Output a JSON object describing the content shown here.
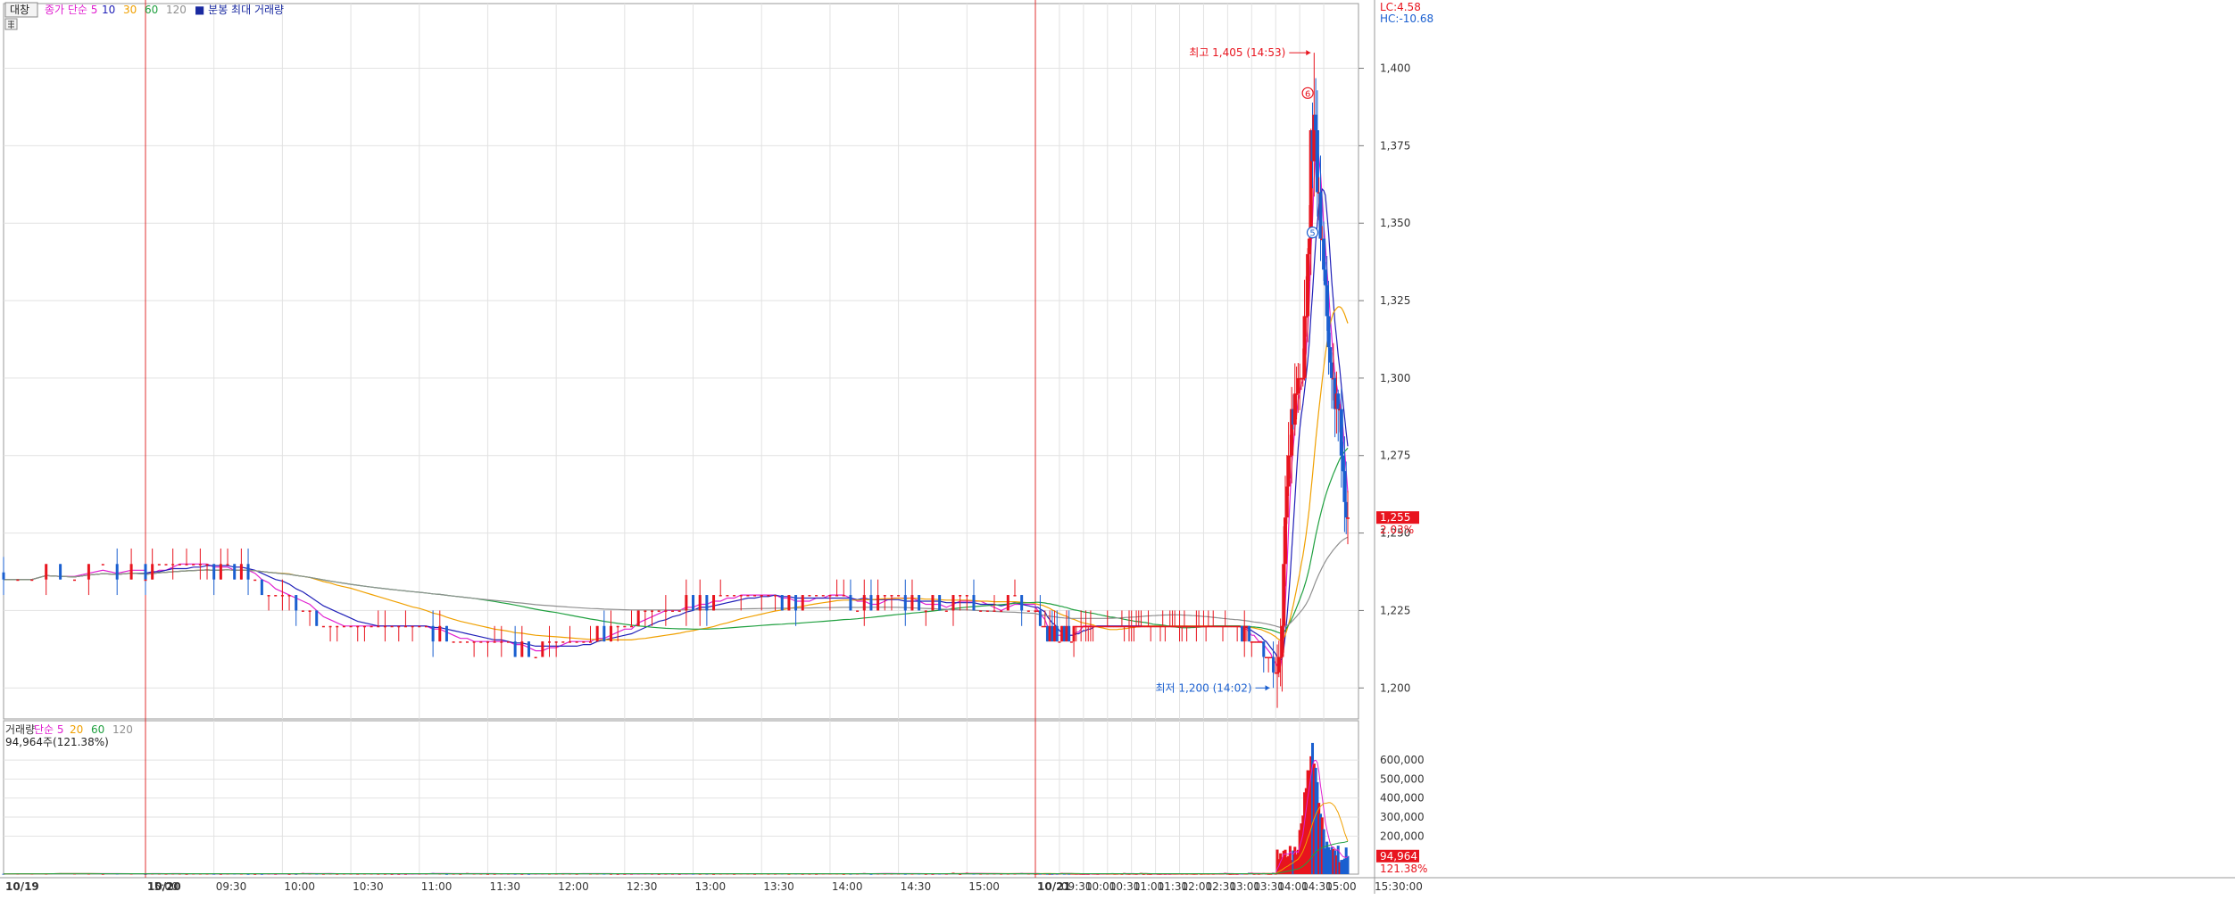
{
  "colors": {
    "up": "#e8141e",
    "down": "#1a5fd0",
    "ma5": "#e020d0",
    "ma10": "#2020b8",
    "ma20": "#f0a000",
    "ma60": "#20a040",
    "ma120": "#909090",
    "grid": "#e2e2e2",
    "axis_text": "#333333",
    "session_line": "#e03030",
    "price_tag_bg": "#e8141e"
  },
  "price_legend": {
    "tool": "대창",
    "items": [
      {
        "text": "종가 단순 5",
        "color": "#e020d0"
      },
      {
        "text": "10",
        "color": "#2020b8"
      },
      {
        "text": "30",
        "color": "#f0a000"
      },
      {
        "text": "60",
        "color": "#20a040"
      },
      {
        "text": "120",
        "color": "#909090"
      },
      {
        "text": "■ 분봉 최대 거래량",
        "color": "#1a2aa0"
      }
    ]
  },
  "volume_legend": {
    "items": [
      {
        "text": "거래량",
        "color": "#333333"
      },
      {
        "text": "단순 5",
        "color": "#e020d0"
      },
      {
        "text": "20",
        "color": "#f0a000"
      },
      {
        "text": "60",
        "color": "#20a040"
      },
      {
        "text": "120",
        "color": "#909090"
      }
    ],
    "current": "94,964주(121.38%)"
  },
  "axis_top": {
    "lc": "LC:4.58",
    "hc": "HC:-10.68"
  },
  "price_axis": {
    "ticks": [
      {
        "value": 1400,
        "label": "1,400"
      },
      {
        "value": 1375,
        "label": "1,375"
      },
      {
        "value": 1350,
        "label": "1,350"
      },
      {
        "value": 1325,
        "label": "1,325"
      },
      {
        "value": 1300,
        "label": "1,300"
      },
      {
        "value": 1275,
        "label": "1,275"
      },
      {
        "value": 1250,
        "label": "1,250"
      },
      {
        "value": 1225,
        "label": "1,225"
      },
      {
        "value": 1200,
        "label": "1,200"
      }
    ],
    "current_price": 1255,
    "current_label": "1,255",
    "current_pct": "2.03%"
  },
  "volume_axis": {
    "ticks": [
      {
        "value": 600000,
        "label": "600,000"
      },
      {
        "value": 500000,
        "label": "500,000"
      },
      {
        "value": 400000,
        "label": "400,000"
      },
      {
        "value": 300000,
        "label": "300,000"
      },
      {
        "value": 200000,
        "label": "200,000"
      }
    ],
    "current_volume": 94964,
    "current_label": "94,964",
    "current_pct": "121.38%"
  },
  "annotations": {
    "high": {
      "text": "최고 1,405 (14:53)",
      "price": 1405
    },
    "low": {
      "text": "최저 1,200 (14:02)",
      "price": 1200
    }
  },
  "signal_marks": [
    "6",
    "5"
  ],
  "time_axis": {
    "labels": [
      "10/19",
      "15:00",
      "10/20",
      "09:30",
      "10:00",
      "10:30",
      "11:00",
      "11:30",
      "12:00",
      "12:30",
      "13:00",
      "13:30",
      "14:00",
      "14:30",
      "15:00",
      "10/21",
      "09:30",
      "10:00",
      "10:30",
      "11:00",
      "11:30",
      "12:00",
      "12:30",
      "13:00",
      "13:30",
      "14:00",
      "14:30",
      "15:00",
      "15:30:00"
    ],
    "bold": [
      "10/19",
      "10/20",
      "10/21"
    ]
  },
  "chart_data": {
    "type": "candlestick",
    "title": "",
    "timeframe": "분봉",
    "price_range": [
      1190,
      1418
    ],
    "volume_range": [
      0,
      760000
    ],
    "sessions": [
      {
        "date": "10/19",
        "visible": "15:00–15:30"
      },
      {
        "date": "10/20",
        "visible": "09:00–15:30"
      },
      {
        "date": "10/21",
        "visible": "09:00–15:30"
      }
    ],
    "key_points": {
      "open_area_price": 1237,
      "day2_range": [
        1210,
        1244
      ],
      "day3_range": [
        1200,
        1405
      ],
      "high": {
        "price": 1405,
        "time": "14:53"
      },
      "low": {
        "price": 1200,
        "time": "14:02"
      },
      "last": 1255
    },
    "moving_averages": [
      "종가 단순 5",
      "10",
      "30",
      "60",
      "120"
    ],
    "volume_moving_averages": [
      "단순 5",
      "20",
      "60",
      "120"
    ],
    "max_volume_approx": 690000
  }
}
